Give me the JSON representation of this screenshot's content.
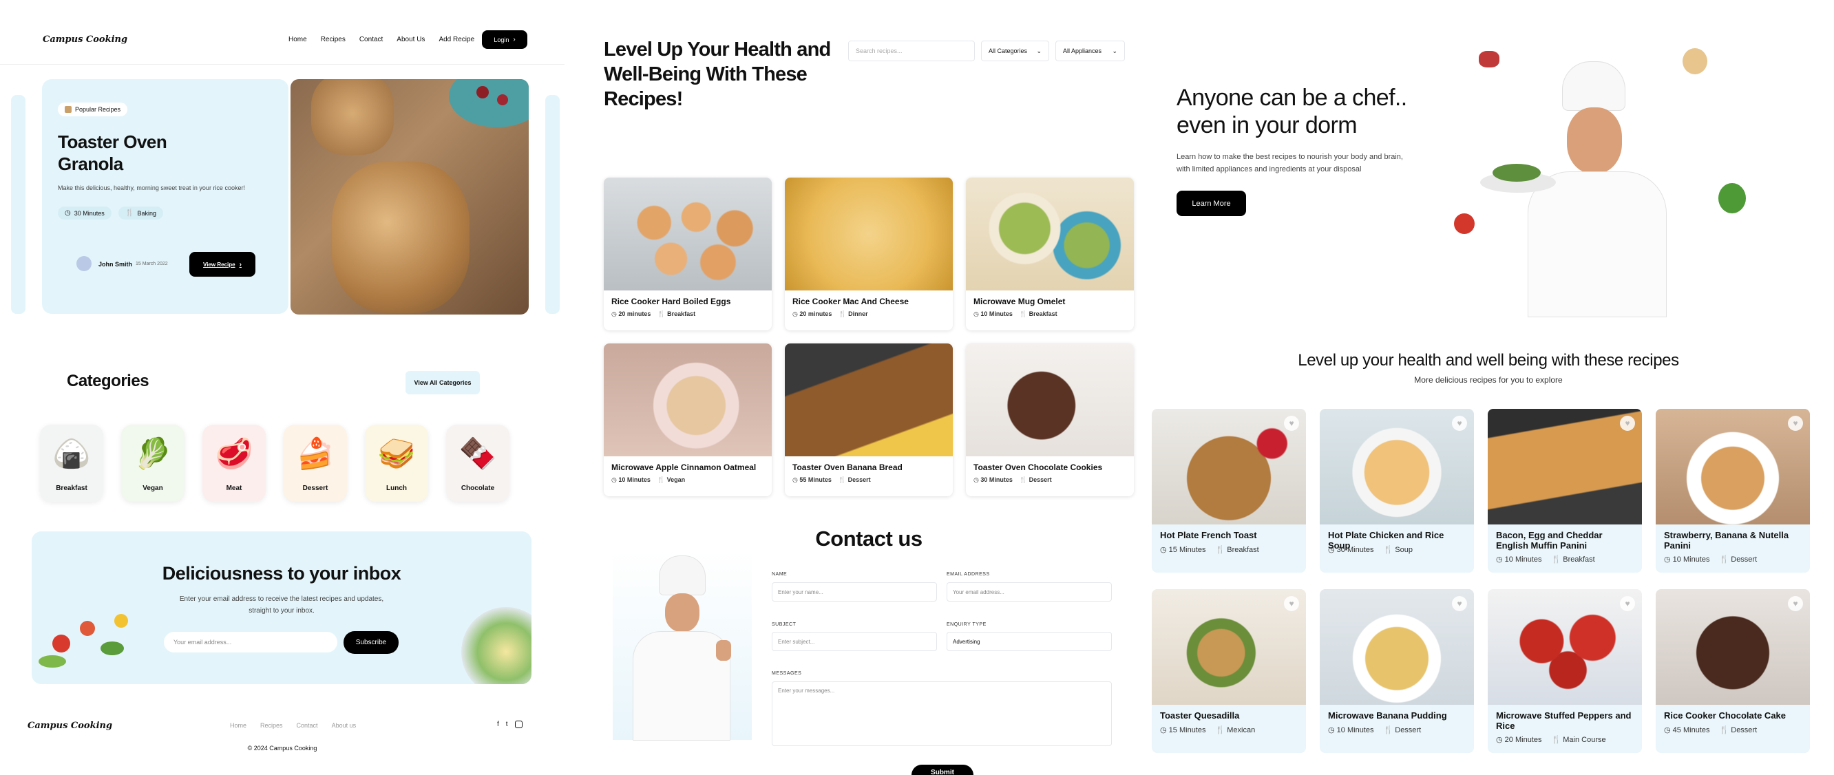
{
  "left": {
    "logo": "Campus Cooking",
    "nav": [
      "Home",
      "Recipes",
      "Contact",
      "About Us",
      "Add Recipe"
    ],
    "login_label": "Login",
    "hero": {
      "badge": "Popular Recipes",
      "title": "Toaster Oven Granola",
      "description": "Make this delicious, healthy, morning sweet treat in your rice cooker!",
      "time": "30 Minutes",
      "category": "Baking",
      "author": "John Smith",
      "date": "15 March 2022",
      "cta": "View Recipe"
    },
    "categories": {
      "title": "Categories",
      "view_all": "View All Categories",
      "items": [
        {
          "label": "Breakfast",
          "emoji": "🍙",
          "bg": "#f3f4f4"
        },
        {
          "label": "Vegan",
          "emoji": "🥬",
          "bg": "#f1f8ee"
        },
        {
          "label": "Meat",
          "emoji": "🥩",
          "bg": "#fdeeee"
        },
        {
          "label": "Dessert",
          "emoji": "🍰",
          "bg": "#fdf3e6"
        },
        {
          "label": "Lunch",
          "emoji": "🥪",
          "bg": "#fcf6e4"
        },
        {
          "label": "Chocolate",
          "emoji": "🍫",
          "bg": "#f6f3f1"
        }
      ]
    },
    "newsletter": {
      "title": "Deliciousness to your inbox",
      "text": "Enter your email address to receive the latest recipes and updates, straight to your inbox.",
      "placeholder": "Your email address...",
      "button": "Subscribe"
    },
    "footer": {
      "logo": "Campus Cooking",
      "links": [
        "Home",
        "Recipes",
        "Contact",
        "About us"
      ],
      "copyright": "© 2024 Campus Cooking"
    }
  },
  "middle": {
    "title": "Level Up Your Health and Well-Being With These Recipes!",
    "search_placeholder": "Search recipes...",
    "filter_categories": "All Categories",
    "filter_appliances": "All Appliances",
    "recipes": [
      {
        "title": "Rice Cooker Hard Boiled Eggs",
        "time": "20 minutes",
        "category": "Breakfast"
      },
      {
        "title": "Rice Cooker Mac And Cheese",
        "time": "20 minutes",
        "category": "Dinner"
      },
      {
        "title": "Microwave Mug Omelet",
        "time": "10 Minutes",
        "category": "Breakfast"
      },
      {
        "title": "Microwave Apple Cinnamon Oatmeal",
        "time": "10 Minutes",
        "category": "Vegan"
      },
      {
        "title": "Toaster Oven Banana Bread",
        "time": "55 Minutes",
        "category": "Dessert"
      },
      {
        "title": "Toaster Oven Chocolate Cookies",
        "time": "30 Minutes",
        "category": "Dessert"
      }
    ],
    "contact": {
      "title": "Contact us",
      "name_label": "NAME",
      "name_placeholder": "Enter your name...",
      "email_label": "EMAIL ADDRESS",
      "email_placeholder": "Your email address...",
      "subject_label": "SUBJECT",
      "subject_placeholder": "Enter subject...",
      "enquiry_label": "ENQUIRY TYPE",
      "enquiry_value": "Advertising",
      "messages_label": "MESSAGES",
      "messages_placeholder": "Enter your messages...",
      "submit": "Submit"
    }
  },
  "right": {
    "hero": {
      "title": "Anyone can be a chef.. even in your dorm",
      "text": "Learn how to make the best recipes to nourish your body and brain, with limited appliances and ingredients at your disposal",
      "cta": "Learn More"
    },
    "section_title": "Level up your health and well being with these recipes",
    "section_subtitle": "More delicious recipes for you to explore",
    "recipes": [
      {
        "title": "Hot Plate French Toast",
        "time": "15 Minutes",
        "category": "Breakfast"
      },
      {
        "title": "Hot Plate Chicken and Rice Soup",
        "time": "30 Minutes",
        "category": "Soup"
      },
      {
        "title": "Bacon, Egg and Cheddar English Muffin Panini",
        "time": "10 Minutes",
        "category": "Breakfast"
      },
      {
        "title": "Strawberry, Banana & Nutella Panini",
        "time": "10 Minutes",
        "category": "Dessert"
      },
      {
        "title": "Toaster Quesadilla",
        "time": "15 Minutes",
        "category": "Mexican"
      },
      {
        "title": "Microwave Banana Pudding",
        "time": "10 Minutes",
        "category": "Dessert"
      },
      {
        "title": "Microwave Stuffed Peppers and Rice",
        "time": "20 Minutes",
        "category": "Main Course"
      },
      {
        "title": "Rice Cooker Chocolate Cake",
        "time": "45 Minutes",
        "category": "Dessert"
      }
    ]
  }
}
